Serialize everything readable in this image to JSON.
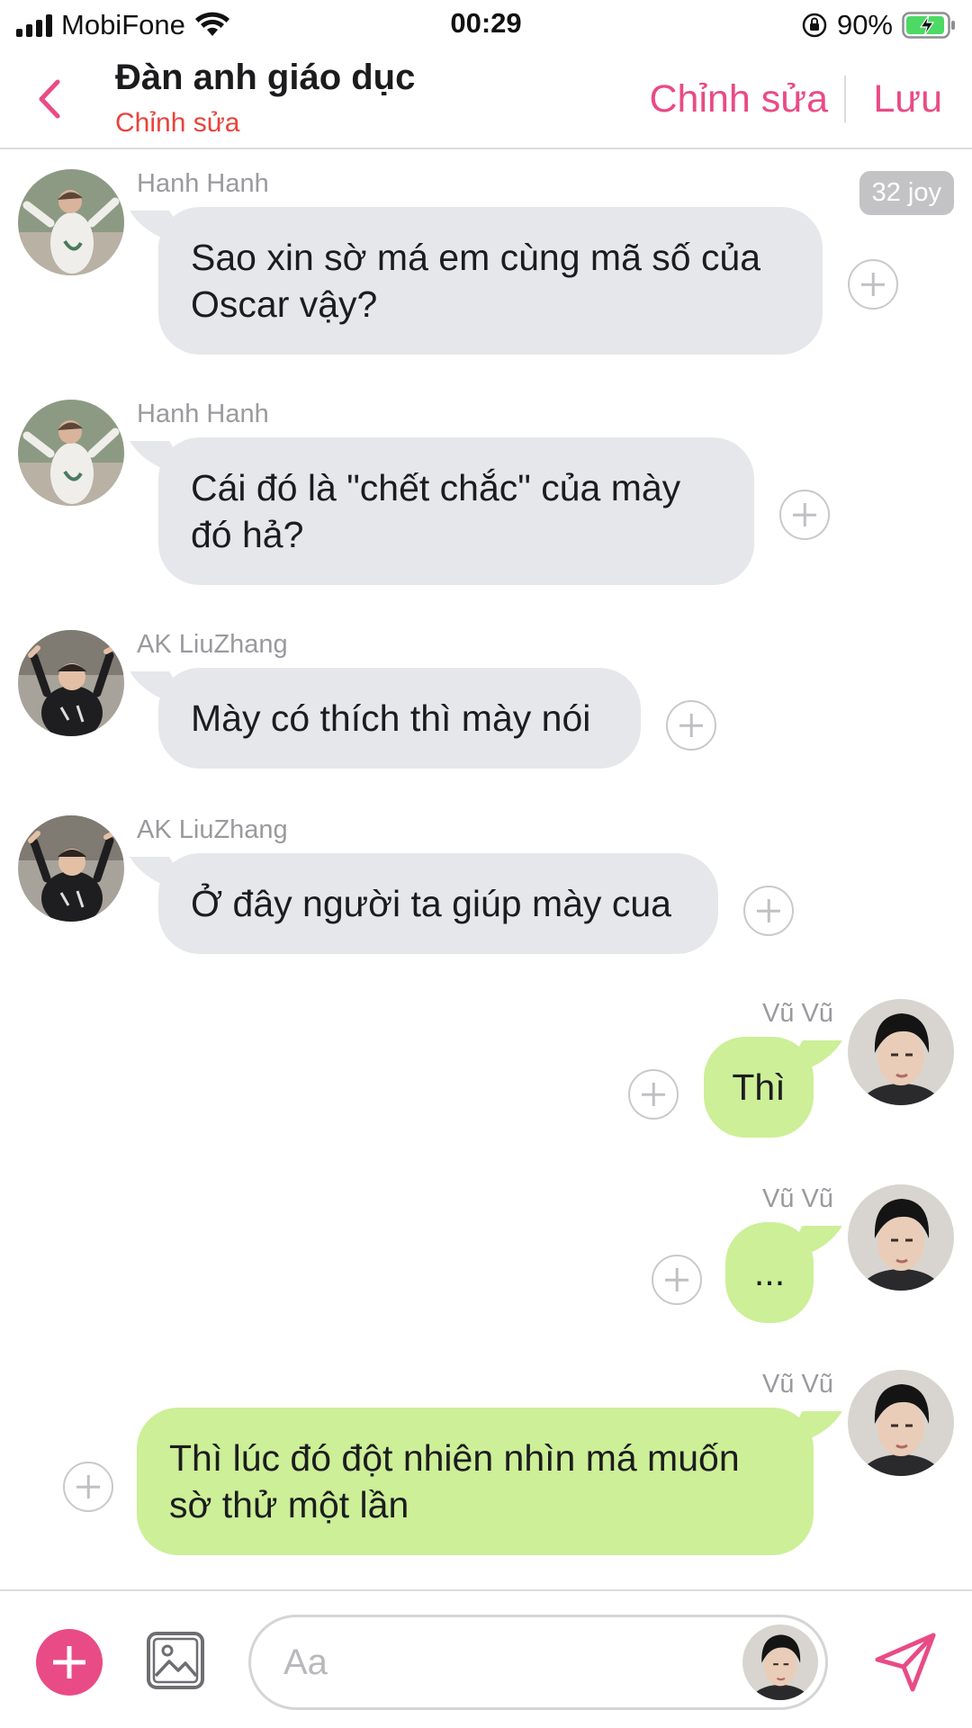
{
  "status_bar": {
    "carrier": "MobiFone",
    "time": "00:29",
    "battery_percent": "90%"
  },
  "header": {
    "title": "Đàn anh giáo dục",
    "subtitle": "Chỉnh sửa",
    "edit_label": "Chỉnh sửa",
    "save_label": "Lưu"
  },
  "badge": "32 joy",
  "messages": [
    {
      "sender": "Hanh Hanh",
      "direction": "in",
      "line1": "Sao xin sờ má em cùng mã số của",
      "line2": "Oscar vậy?"
    },
    {
      "sender": "Hanh Hanh",
      "direction": "in",
      "line1": "Cái đó là \"chết chắc\" của mày",
      "line2": "đó hả?"
    },
    {
      "sender": "AK LiuZhang",
      "direction": "in",
      "line1": "Mày có thích thì mày nói"
    },
    {
      "sender": "AK LiuZhang",
      "direction": "in",
      "line1": "Ở đây người ta giúp mày cua"
    },
    {
      "sender": "Vũ Vũ",
      "direction": "out",
      "line1": "Thì"
    },
    {
      "sender": "Vũ Vũ",
      "direction": "out",
      "line1": "..."
    },
    {
      "sender": "Vũ Vũ",
      "direction": "out",
      "line1": "Thì lúc đó đột nhiên nhìn má muốn",
      "line2": "sờ thử một lần"
    }
  ],
  "composer": {
    "placeholder": "Aa"
  },
  "colors": {
    "accent": "#e94b86",
    "subtitle": "#e8433b",
    "incoming_bubble": "#e6e7eb",
    "outgoing_bubble": "#ccef97"
  }
}
